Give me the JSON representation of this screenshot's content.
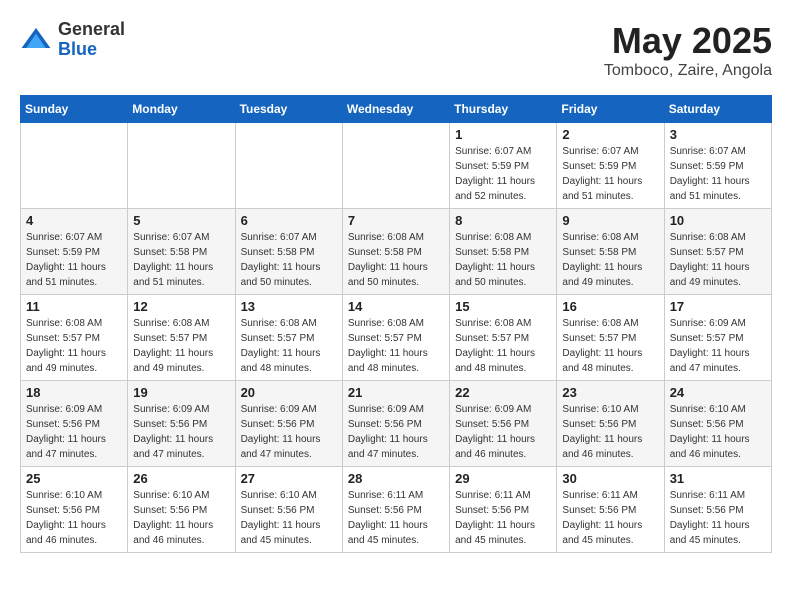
{
  "logo": {
    "general": "General",
    "blue": "Blue"
  },
  "title": "May 2025",
  "location": "Tomboco, Zaire, Angola",
  "days_of_week": [
    "Sunday",
    "Monday",
    "Tuesday",
    "Wednesday",
    "Thursday",
    "Friday",
    "Saturday"
  ],
  "weeks": [
    [
      {
        "day": "",
        "info": ""
      },
      {
        "day": "",
        "info": ""
      },
      {
        "day": "",
        "info": ""
      },
      {
        "day": "",
        "info": ""
      },
      {
        "day": "1",
        "info": "Sunrise: 6:07 AM\nSunset: 5:59 PM\nDaylight: 11 hours\nand 52 minutes."
      },
      {
        "day": "2",
        "info": "Sunrise: 6:07 AM\nSunset: 5:59 PM\nDaylight: 11 hours\nand 51 minutes."
      },
      {
        "day": "3",
        "info": "Sunrise: 6:07 AM\nSunset: 5:59 PM\nDaylight: 11 hours\nand 51 minutes."
      }
    ],
    [
      {
        "day": "4",
        "info": "Sunrise: 6:07 AM\nSunset: 5:59 PM\nDaylight: 11 hours\nand 51 minutes."
      },
      {
        "day": "5",
        "info": "Sunrise: 6:07 AM\nSunset: 5:58 PM\nDaylight: 11 hours\nand 51 minutes."
      },
      {
        "day": "6",
        "info": "Sunrise: 6:07 AM\nSunset: 5:58 PM\nDaylight: 11 hours\nand 50 minutes."
      },
      {
        "day": "7",
        "info": "Sunrise: 6:08 AM\nSunset: 5:58 PM\nDaylight: 11 hours\nand 50 minutes."
      },
      {
        "day": "8",
        "info": "Sunrise: 6:08 AM\nSunset: 5:58 PM\nDaylight: 11 hours\nand 50 minutes."
      },
      {
        "day": "9",
        "info": "Sunrise: 6:08 AM\nSunset: 5:58 PM\nDaylight: 11 hours\nand 49 minutes."
      },
      {
        "day": "10",
        "info": "Sunrise: 6:08 AM\nSunset: 5:57 PM\nDaylight: 11 hours\nand 49 minutes."
      }
    ],
    [
      {
        "day": "11",
        "info": "Sunrise: 6:08 AM\nSunset: 5:57 PM\nDaylight: 11 hours\nand 49 minutes."
      },
      {
        "day": "12",
        "info": "Sunrise: 6:08 AM\nSunset: 5:57 PM\nDaylight: 11 hours\nand 49 minutes."
      },
      {
        "day": "13",
        "info": "Sunrise: 6:08 AM\nSunset: 5:57 PM\nDaylight: 11 hours\nand 48 minutes."
      },
      {
        "day": "14",
        "info": "Sunrise: 6:08 AM\nSunset: 5:57 PM\nDaylight: 11 hours\nand 48 minutes."
      },
      {
        "day": "15",
        "info": "Sunrise: 6:08 AM\nSunset: 5:57 PM\nDaylight: 11 hours\nand 48 minutes."
      },
      {
        "day": "16",
        "info": "Sunrise: 6:08 AM\nSunset: 5:57 PM\nDaylight: 11 hours\nand 48 minutes."
      },
      {
        "day": "17",
        "info": "Sunrise: 6:09 AM\nSunset: 5:57 PM\nDaylight: 11 hours\nand 47 minutes."
      }
    ],
    [
      {
        "day": "18",
        "info": "Sunrise: 6:09 AM\nSunset: 5:56 PM\nDaylight: 11 hours\nand 47 minutes."
      },
      {
        "day": "19",
        "info": "Sunrise: 6:09 AM\nSunset: 5:56 PM\nDaylight: 11 hours\nand 47 minutes."
      },
      {
        "day": "20",
        "info": "Sunrise: 6:09 AM\nSunset: 5:56 PM\nDaylight: 11 hours\nand 47 minutes."
      },
      {
        "day": "21",
        "info": "Sunrise: 6:09 AM\nSunset: 5:56 PM\nDaylight: 11 hours\nand 47 minutes."
      },
      {
        "day": "22",
        "info": "Sunrise: 6:09 AM\nSunset: 5:56 PM\nDaylight: 11 hours\nand 46 minutes."
      },
      {
        "day": "23",
        "info": "Sunrise: 6:10 AM\nSunset: 5:56 PM\nDaylight: 11 hours\nand 46 minutes."
      },
      {
        "day": "24",
        "info": "Sunrise: 6:10 AM\nSunset: 5:56 PM\nDaylight: 11 hours\nand 46 minutes."
      }
    ],
    [
      {
        "day": "25",
        "info": "Sunrise: 6:10 AM\nSunset: 5:56 PM\nDaylight: 11 hours\nand 46 minutes."
      },
      {
        "day": "26",
        "info": "Sunrise: 6:10 AM\nSunset: 5:56 PM\nDaylight: 11 hours\nand 46 minutes."
      },
      {
        "day": "27",
        "info": "Sunrise: 6:10 AM\nSunset: 5:56 PM\nDaylight: 11 hours\nand 45 minutes."
      },
      {
        "day": "28",
        "info": "Sunrise: 6:11 AM\nSunset: 5:56 PM\nDaylight: 11 hours\nand 45 minutes."
      },
      {
        "day": "29",
        "info": "Sunrise: 6:11 AM\nSunset: 5:56 PM\nDaylight: 11 hours\nand 45 minutes."
      },
      {
        "day": "30",
        "info": "Sunrise: 6:11 AM\nSunset: 5:56 PM\nDaylight: 11 hours\nand 45 minutes."
      },
      {
        "day": "31",
        "info": "Sunrise: 6:11 AM\nSunset: 5:56 PM\nDaylight: 11 hours\nand 45 minutes."
      }
    ]
  ]
}
